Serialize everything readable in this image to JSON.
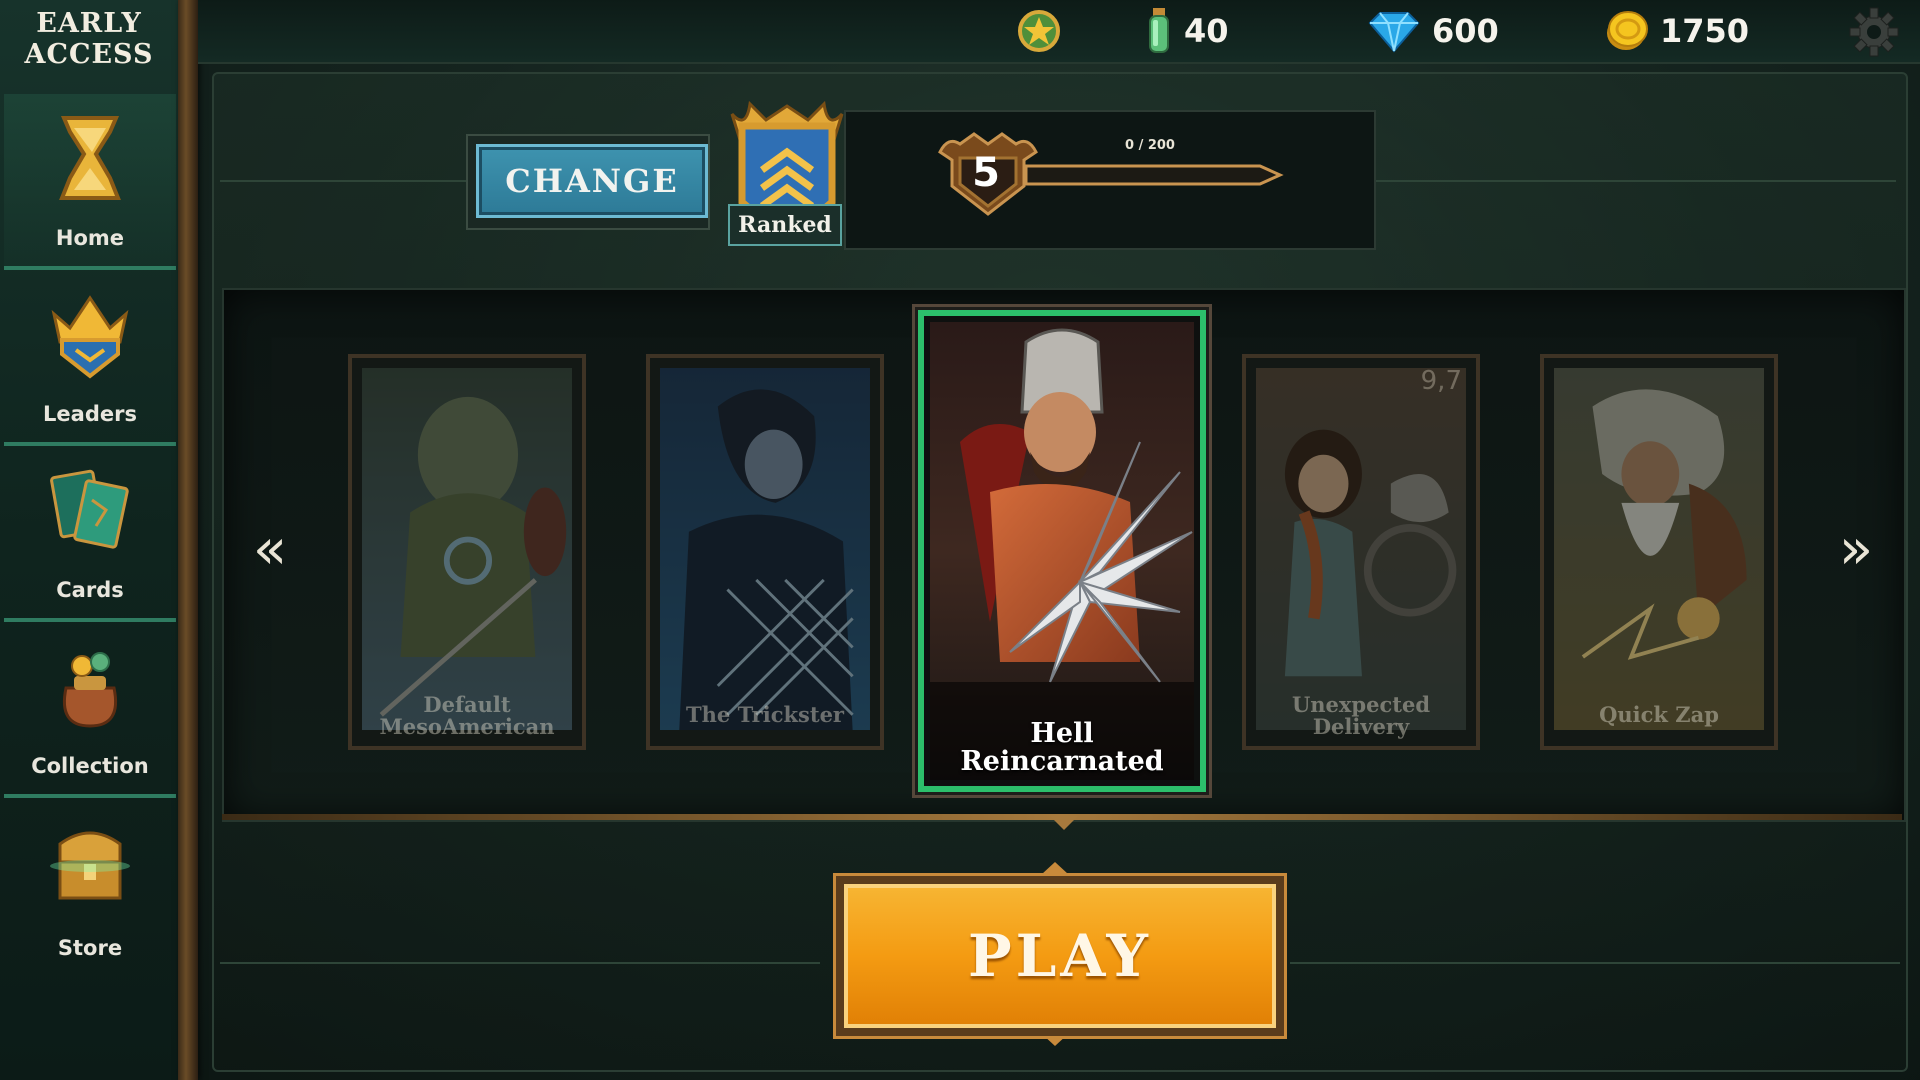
{
  "sidebar": {
    "early_access": "EARLY\nACCESS",
    "items": [
      {
        "label": "Home",
        "icon": "hourglass-icon"
      },
      {
        "label": "Leaders",
        "icon": "crown-shield-icon"
      },
      {
        "label": "Cards",
        "icon": "cards-icon"
      },
      {
        "label": "Collection",
        "icon": "loot-bag-icon"
      },
      {
        "label": "Store",
        "icon": "chest-icon"
      }
    ]
  },
  "topbar": {
    "resources": [
      {
        "icon": "star-medal-icon",
        "value": ""
      },
      {
        "icon": "potion-vial-icon",
        "value": "40"
      },
      {
        "icon": "gem-icon",
        "value": "600"
      },
      {
        "icon": "gold-coin-icon",
        "value": "1750"
      }
    ],
    "settings_icon": "gear-icon"
  },
  "mode": {
    "change_label": "CHANGE",
    "ranked_label": "Ranked"
  },
  "progress": {
    "level": "5",
    "xp_text": "0 / 200",
    "xp_fraction": 0.0
  },
  "carousel": {
    "cards": [
      {
        "title": "Default\nMesoAmerican",
        "selected": false
      },
      {
        "title": "The Trickster",
        "selected": false
      },
      {
        "title": "Hell\nReincarnated",
        "selected": true
      },
      {
        "title": "Unexpected\nDelivery",
        "selected": false,
        "corner": "9,7"
      },
      {
        "title": "Quick Zap",
        "selected": false
      }
    ],
    "prev": "«",
    "next": "»"
  },
  "play": {
    "label": "PLAY"
  },
  "colors": {
    "accent_green": "#2cbf6b",
    "change_blue": "#3e93af",
    "play_orange": "#f49b12",
    "gold": "#c9963f"
  }
}
